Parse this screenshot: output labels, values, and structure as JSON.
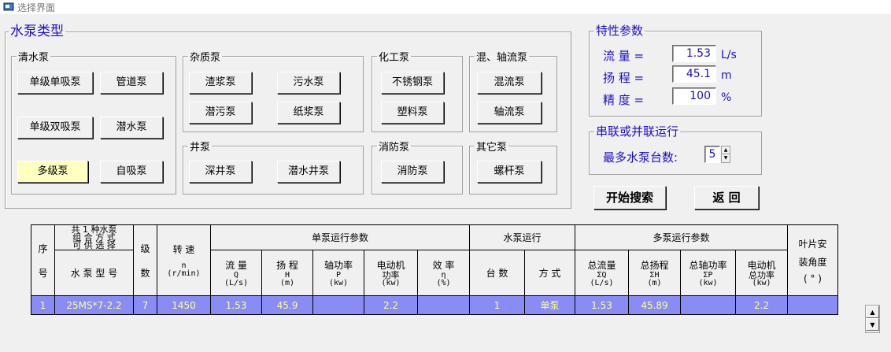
{
  "window": {
    "title": "选择界面"
  },
  "pump_types": {
    "legend": "水泵类型",
    "groups": {
      "clear": {
        "legend": "清水泵",
        "buttons": [
          "单级单吸泵",
          "管道泵",
          "单级双吸泵",
          "潜水泵",
          "多级泵",
          "自吸泵"
        ]
      },
      "impurity": {
        "legend": "杂质泵",
        "buttons": [
          "渣浆泵",
          "污水泵",
          "潜污泵",
          "纸浆泵"
        ]
      },
      "chemical": {
        "legend": "化工泵",
        "buttons": [
          "不锈钢泵",
          "塑料泵"
        ]
      },
      "mixed": {
        "legend": "混、轴流泵",
        "buttons": [
          "混流泵",
          "轴流泵"
        ]
      },
      "well": {
        "legend": "井泵",
        "buttons": [
          "深井泵",
          "潜水井泵"
        ]
      },
      "fire": {
        "legend": "消防泵",
        "buttons": [
          "消防泵"
        ]
      },
      "other": {
        "legend": "其它泵",
        "buttons": [
          "螺杆泵"
        ]
      }
    },
    "selected": "多级泵"
  },
  "params": {
    "legend": "特性参数",
    "flow": {
      "label": "流  量 =",
      "value": "1.53",
      "unit": "L/s"
    },
    "head": {
      "label": "扬  程 =",
      "value": "45.1",
      "unit": "m"
    },
    "precision": {
      "label": "精  度 =",
      "value": "100",
      "unit": "%"
    }
  },
  "series": {
    "legend": "串联或并联运行",
    "label": "最多水泵台数:",
    "value": "5"
  },
  "actions": {
    "search": "开始搜索",
    "back": "返  回"
  },
  "table": {
    "h_seq": [
      "序",
      "号"
    ],
    "h_combo": [
      "共 1 种水泵",
      "组 合 方 式",
      "可 供 选 择"
    ],
    "h_model": "水 泵 型 号",
    "h_stage": [
      "级",
      "数"
    ],
    "h_speed": [
      "转  速",
      "n",
      "(r/min)"
    ],
    "h_single": "单泵运行参数",
    "h_flow": [
      "流  量",
      "Q",
      "(L/s)"
    ],
    "h_head": [
      "扬  程",
      "H",
      "(m)"
    ],
    "h_shaft": [
      "轴功率",
      "P",
      "(kw)"
    ],
    "h_motor": [
      "电动机",
      "功率",
      "(kw)"
    ],
    "h_eff": [
      "效  率",
      "η",
      "(%)"
    ],
    "h_run": "水泵运行",
    "h_count": "台  数",
    "h_mode": "方  式",
    "h_multi": "多泵运行参数",
    "h_tq": [
      "总流量",
      "ΣQ",
      "(L/s)"
    ],
    "h_th": [
      "总扬程",
      "ΣH",
      "(m)"
    ],
    "h_tp": [
      "总轴功率",
      "ΣP",
      "(kw)"
    ],
    "h_tm": [
      "电动机",
      "总功率",
      "(kw)"
    ],
    "h_blade": [
      "叶片安",
      "装角度",
      "( ° )"
    ],
    "row": {
      "seq": "1",
      "model": "25MS*7-2.2",
      "stage": "7",
      "speed": "1450",
      "flow": "1.53",
      "head": "45.9",
      "shaft": "",
      "motor": "2.2",
      "eff": "",
      "count": "1",
      "mode": "单泵",
      "tq": "1.53",
      "th": "45.89",
      "tp": "",
      "tm": "2.2",
      "blade": ""
    }
  },
  "colors": {
    "accent_text": "#1a0dcc",
    "selected_row": "#8a8cf5",
    "row_text": "#ffff8c",
    "selected_button": "#ffffc0"
  }
}
